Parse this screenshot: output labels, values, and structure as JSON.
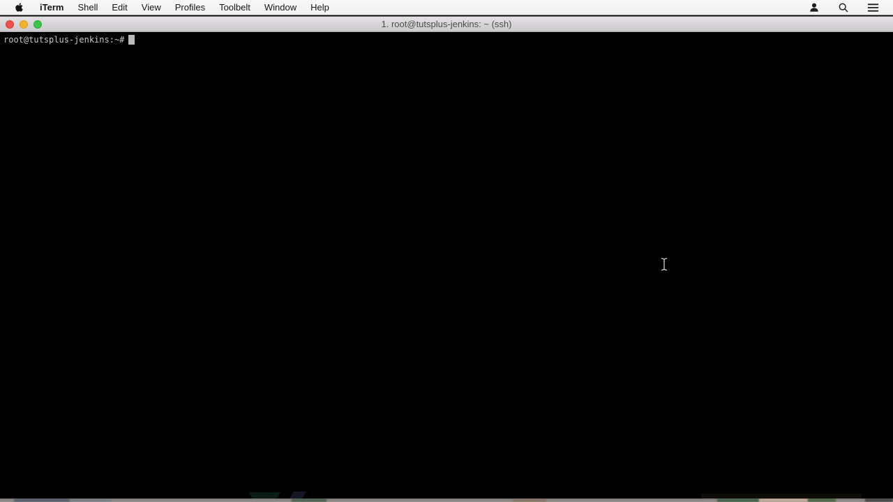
{
  "menu_bar": {
    "apple_logo": "apple-logo",
    "app_name": "iTerm",
    "items": [
      "Shell",
      "Edit",
      "View",
      "Profiles",
      "Toolbelt",
      "Window",
      "Help"
    ],
    "status_icons": [
      "user-icon",
      "search-icon",
      "notification-list-icon"
    ]
  },
  "window": {
    "title": "1. root@tutsplus-jenkins: ~ (ssh)",
    "traffic_lights": {
      "close": "#f0504a",
      "minimize": "#f6b22d",
      "zoom": "#3ac24b"
    }
  },
  "terminal": {
    "prompt": "root@tutsplus-jenkins:~#",
    "cursor_style": "block",
    "background_color": "#000000",
    "text_color": "#c8c8c8"
  },
  "pointer": {
    "type": "text-ibeam"
  }
}
